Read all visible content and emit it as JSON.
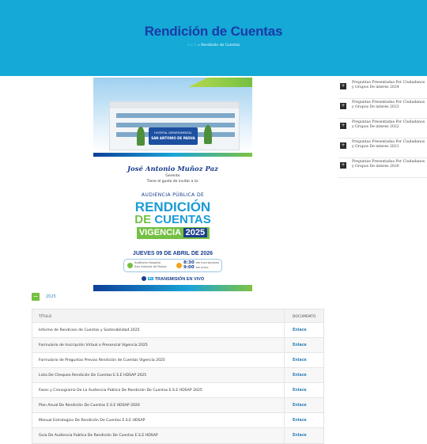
{
  "hero": {
    "title": "Rendición de Cuentas",
    "breadcrumb_home": "Inicio",
    "breadcrumb_current": "» Rendición de Cuentas"
  },
  "poster": {
    "hospital_line1": "HOSPITAL DEPARTAMENTAL",
    "hospital_line2": "SAN ANTONIO DE PADUA",
    "name": "José Antonio Muñoz Paz",
    "role": "Gerente",
    "invite": "Tiene el gusto de invitar a la:",
    "audiencia": "AUDIENCIA PÚBLICA DE",
    "rendicion": "RENDICIÓN",
    "de": "DE",
    "cuentas": "CUENTAS",
    "vigencia": "VIGENCIA",
    "year": "2025",
    "date": "JUEVES 09 DE ABRIL DE 2026",
    "location": "Auditorio Hospital\nSan Antonio de Padua",
    "time_am": "8:30",
    "time_am_suffix": "am Inscripciones",
    "time_am2": "9:00",
    "time_am2_suffix": "am Inicio",
    "live_badge": "EN",
    "live": "TRANSMISIÓN EN VIVO"
  },
  "year_section": {
    "toggle": "−",
    "year": "2025"
  },
  "table": {
    "header_title": "TÍTULO",
    "header_doc": "DOCUMENTO",
    "rows": [
      {
        "title": "Informe de Rendicion de Cuentas y Sostenibilidad 2025",
        "link": "Enlace"
      },
      {
        "title": "Formulario de Inscripción Virtual o Presencial Vigencia 2025",
        "link": "Enlace"
      },
      {
        "title": "Formulario de Preguntas Previas Rendición de Cuentas Vigencia 2025",
        "link": "Enlace"
      },
      {
        "title": "Lista De Chequeo Rendición De Cuentas E.S.E HDSAP 2025",
        "link": "Enlace"
      },
      {
        "title": "Fases y Cronograma De La Audiencia Pública De Rendición De Cuentas E.S.E HDSAP 2025",
        "link": "Enlace"
      },
      {
        "title": "Plan Anual De Rendición De Cuentas E.S.E HDSAP 2026",
        "link": "Enlace"
      },
      {
        "title": "Manual Estrategico De Rendición De Cuentas E.S.E HDSAP",
        "link": "Enlace"
      },
      {
        "title": "Guia De Audiencia Publica De Rendición De Cuentas E.S.E HDSAP",
        "link": "Enlace"
      }
    ]
  },
  "sidebar": {
    "icon": "+",
    "items": [
      {
        "label": "Preguntas Presentadas Por Ciudadanos y Grupos De interes 2024"
      },
      {
        "label": "Preguntas Presentadas Por Ciudadanos y Grupos De interes 2023"
      },
      {
        "label": "Preguntas Presentadas Por Ciudadanos y Grupos De interes 2022"
      },
      {
        "label": "Preguntas Presentadas Por Ciudadanos y Grupos De interes 2021"
      },
      {
        "label": "Preguntas Presentadas Por Ciudadanos y Grupos De interes 2020"
      }
    ]
  },
  "colors": {
    "hero_bg": "#14a9d6",
    "hero_title": "#1a3aa8",
    "accent_green": "#74c043",
    "link_blue": "#2b7fb8"
  }
}
